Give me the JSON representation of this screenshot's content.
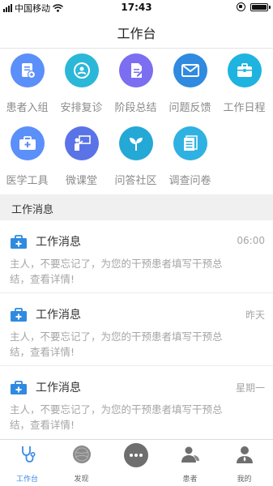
{
  "status_bar": {
    "carrier": "中国移动",
    "time": "17:43"
  },
  "navbar": {
    "title": "工作台"
  },
  "grid": {
    "items": [
      {
        "label": "患者入组",
        "icon": "patient-enroll-icon",
        "color": "#5b8ff9"
      },
      {
        "label": "安排复诊",
        "icon": "schedule-revisit-icon",
        "color": "#2bb7d8"
      },
      {
        "label": "阶段总结",
        "icon": "stage-summary-icon",
        "color": "#7b6ef0"
      },
      {
        "label": "问题反馈",
        "icon": "feedback-mail-icon",
        "color": "#2f8ae0"
      },
      {
        "label": "工作日程",
        "icon": "work-schedule-icon",
        "color": "#1fb3e0"
      },
      {
        "label": "医学工具",
        "icon": "medical-tools-icon",
        "color": "#5b8ff9"
      },
      {
        "label": "微课堂",
        "icon": "micro-class-icon",
        "color": "#5a73e6"
      },
      {
        "label": "问答社区",
        "icon": "qa-community-icon",
        "color": "#24a8d6"
      },
      {
        "label": "调查问卷",
        "icon": "survey-icon",
        "color": "#2fb1e2"
      }
    ]
  },
  "section": {
    "title": "工作消息"
  },
  "messages": [
    {
      "title": "工作消息",
      "time": "06:00",
      "body": "主人，不要忘记了，为您的干预患者填写干预总结，查看详情!"
    },
    {
      "title": "工作消息",
      "time": "昨天",
      "body": "主人，不要忘记了，为您的干预患者填写干预总结，查看详情!"
    },
    {
      "title": "工作消息",
      "time": "星期一",
      "body": "主人，不要忘记了，为您的干预患者填写干预总结，查看详情!"
    }
  ],
  "tabbar": {
    "active_color": "#3a8be6",
    "items": [
      {
        "label": "工作台",
        "icon": "stethoscope-icon"
      },
      {
        "label": "发现",
        "icon": "discover-icon"
      },
      {
        "label": "",
        "icon": "chat-bubble-icon"
      },
      {
        "label": "患者",
        "icon": "patients-icon"
      },
      {
        "label": "我的",
        "icon": "profile-icon"
      }
    ]
  }
}
